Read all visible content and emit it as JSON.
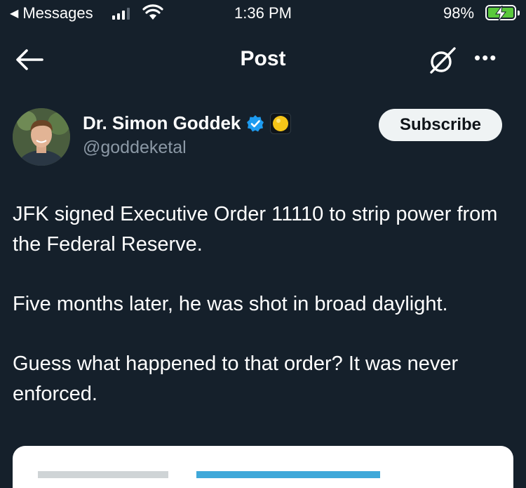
{
  "status_bar": {
    "back_app": "Messages",
    "time": "1:36 PM",
    "battery_percent": "98%",
    "signal_bars": 3,
    "wifi_icon": "wifi-icon",
    "battery_icon": "battery-charging-icon"
  },
  "header": {
    "title": "Post",
    "back_icon": "back-arrow-icon",
    "grok_icon": "grok-icon",
    "more_icon": "more-horizontal-icon"
  },
  "author": {
    "name": "Dr. Simon Goddek",
    "handle": "@goddeketal",
    "verified_icon": "verified-badge-icon",
    "affiliate_icon": "affiliate-badge-icon",
    "subscribe_label": "Subscribe"
  },
  "post": {
    "paragraphs": [
      "JFK signed Executive Order 11110 to strip power from the Federal Reserve.",
      "Five months later, he was shot in broad daylight.",
      "Guess what happened to that order? It was never enforced."
    ]
  },
  "colors": {
    "background": "#15202b",
    "verified_blue": "#1d9bf0",
    "subscribe_bg": "#eff3f4",
    "handle_gray": "#8b98a5"
  }
}
